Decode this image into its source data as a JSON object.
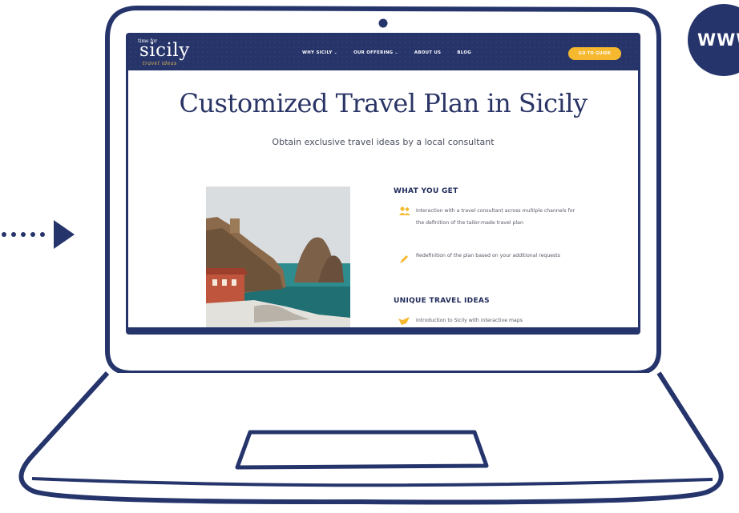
{
  "badge": {
    "text": "WWW"
  },
  "site": {
    "logo": {
      "top": "time for",
      "main": "sicily",
      "sub": "travel ideas"
    },
    "nav": [
      {
        "label": "WHY SICILY",
        "dropdown": true
      },
      {
        "label": "OUR OFFERING",
        "dropdown": true
      },
      {
        "label": "ABOUT US",
        "dropdown": false
      },
      {
        "label": "BLOG",
        "dropdown": false
      }
    ],
    "cta": "GO TO GUIDE"
  },
  "hero": {
    "title": "Customized Travel Plan in Sicily",
    "subtitle": "Obtain exclusive travel ideas by a local consultant"
  },
  "sections": {
    "what_you_get": {
      "heading": "WHAT YOU GET",
      "items": [
        {
          "icon": "people-icon",
          "text": "Interaction with a travel consultant across multiple channels for the definition of the tailor-made travel plan"
        },
        {
          "icon": "pencil-icon",
          "text": "Redefinition of the plan based on your additional requests"
        }
      ]
    },
    "unique_travel_ideas": {
      "heading": "UNIQUE TRAVEL IDEAS",
      "items": [
        {
          "icon": "map-icon",
          "text": "Introduction to Sicily with interactive maps"
        }
      ]
    }
  },
  "colors": {
    "navy": "#25346b",
    "accent": "#f5b82e"
  }
}
